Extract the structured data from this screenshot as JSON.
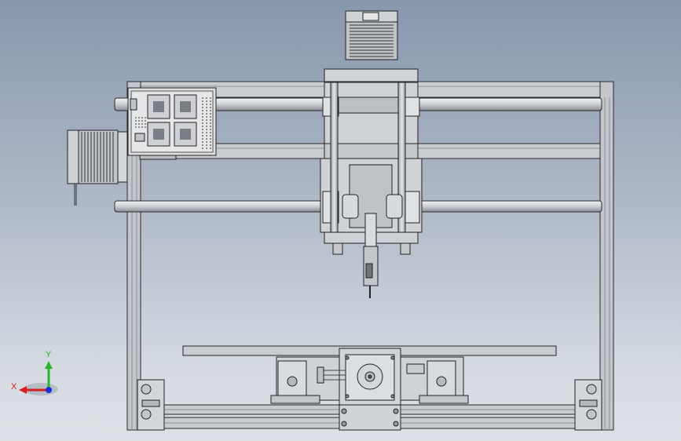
{
  "viewport": {
    "triad": {
      "y_label": "Y",
      "x_label": "X",
      "y_color": "#2bb52b",
      "x_color": "#d42020",
      "z_color": "#1d2fd8"
    },
    "model_colors": {
      "frame": "#c8ccd2",
      "frame_dark": "#9ea3aa",
      "rod": "#d3d6da",
      "edge": "#2a2a2a",
      "board": "#d8dadc"
    }
  }
}
